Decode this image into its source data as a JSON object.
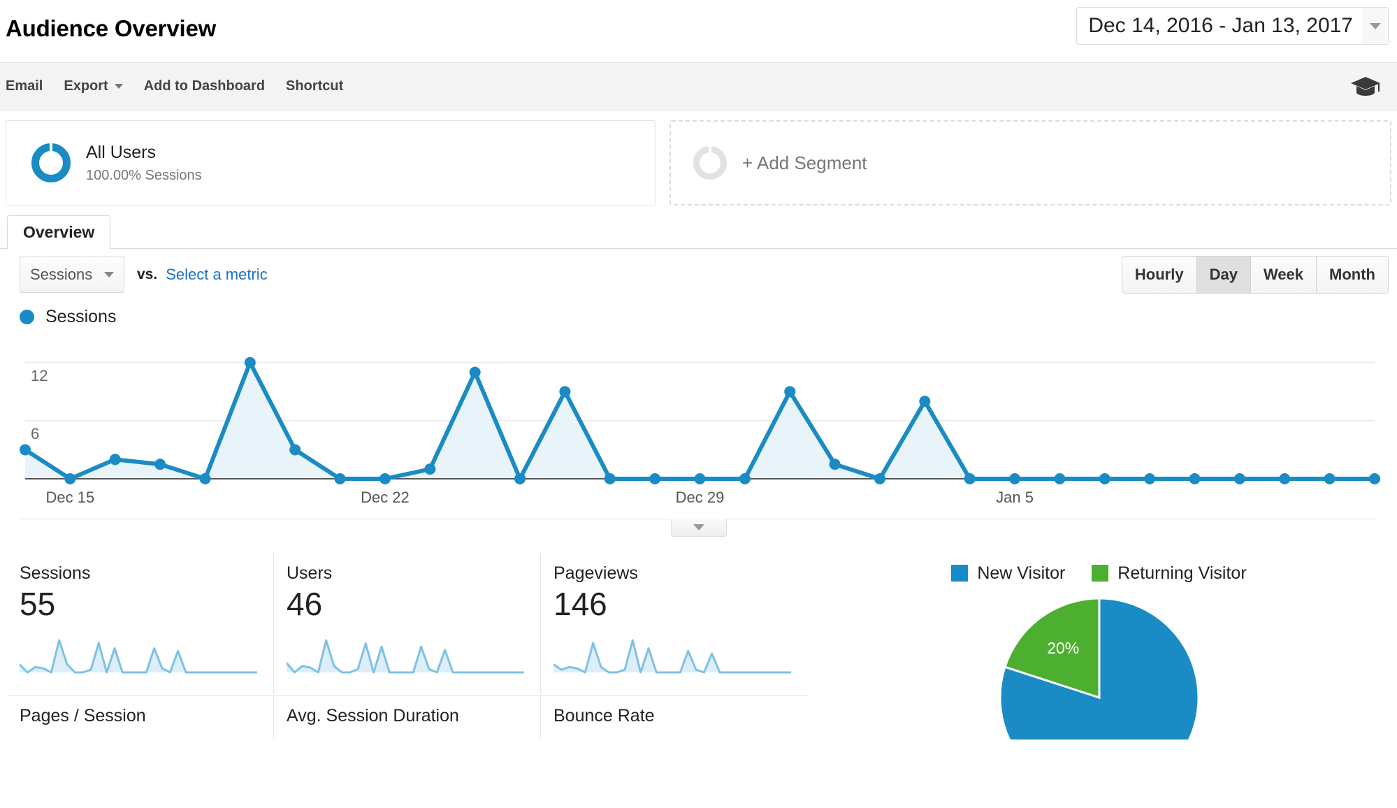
{
  "header": {
    "title": "Audience Overview",
    "date_range": "Dec 14, 2016 - Jan 13, 2017",
    "date_caret_icon": "chevron-down-icon"
  },
  "toolbar": {
    "items": [
      {
        "label": "Email",
        "has_caret": false
      },
      {
        "label": "Export",
        "has_caret": true
      },
      {
        "label": "Add to Dashboard",
        "has_caret": false
      },
      {
        "label": "Shortcut",
        "has_caret": false
      }
    ],
    "help_icon": "graduation-cap-icon"
  },
  "segments": {
    "applied": {
      "name": "All Users",
      "sub": "100.00% Sessions",
      "icon": "segment-ring-icon"
    },
    "add": {
      "label": "+ Add Segment",
      "icon": "segment-ring-icon"
    }
  },
  "tabs": [
    {
      "label": "Overview",
      "active": true
    }
  ],
  "metric_selector": {
    "primary_metric": "Sessions",
    "vs_label": "vs.",
    "secondary_metric_link": "Select a metric",
    "caret_icon": "chevron-down-icon"
  },
  "granularity": {
    "options": [
      "Hourly",
      "Day",
      "Week",
      "Month"
    ],
    "selected": "Day"
  },
  "chart_legend": {
    "label": "Sessions",
    "color": "#1a8bc4"
  },
  "chart_expand": {
    "icon": "chevron-down-icon"
  },
  "metrics": [
    {
      "name": "Sessions",
      "value": "55"
    },
    {
      "name": "Users",
      "value": "46"
    },
    {
      "name": "Pageviews",
      "value": "146"
    },
    {
      "name": "Pages / Session",
      "value": ""
    },
    {
      "name": "Avg. Session Duration",
      "value": ""
    },
    {
      "name": "Bounce Rate",
      "value": ""
    }
  ],
  "visitor_pie": {
    "legend": [
      {
        "label": "New Visitor",
        "color": "#1a8bc4"
      },
      {
        "label": "Returning Visitor",
        "color": "#4caf2f"
      }
    ],
    "slice_label": "20%"
  },
  "colors": {
    "accent_blue": "#1a8bc4",
    "green": "#4caf2f",
    "area_fill": "#e8f3fa",
    "link_blue": "#1a73c8"
  },
  "chart_data": {
    "type": "line",
    "title": "Sessions",
    "xlabel": "",
    "ylabel": "Sessions",
    "ylim": [
      0,
      13.5
    ],
    "yticks": [
      6,
      12
    ],
    "grid": true,
    "legend_position": "top-left",
    "x": [
      "Dec 14",
      "Dec 15",
      "Dec 16",
      "Dec 17",
      "Dec 18",
      "Dec 19",
      "Dec 20",
      "Dec 21",
      "Dec 22",
      "Dec 23",
      "Dec 24",
      "Dec 25",
      "Dec 26",
      "Dec 27",
      "Dec 28",
      "Dec 29",
      "Dec 30",
      "Dec 31",
      "Jan 1",
      "Jan 2",
      "Jan 3",
      "Jan 4",
      "Jan 5",
      "Jan 6",
      "Jan 7",
      "Jan 8",
      "Jan 9",
      "Jan 10",
      "Jan 11",
      "Jan 12",
      "Jan 13"
    ],
    "tick_labels": [
      "Dec 15",
      "Dec 22",
      "Dec 29",
      "Jan 5"
    ],
    "tick_indices": [
      1,
      8,
      15,
      22
    ],
    "series": [
      {
        "name": "Sessions",
        "color": "#1a8bc4",
        "values": [
          3,
          0,
          2,
          1.5,
          0,
          12,
          3,
          0,
          0,
          1,
          11,
          0,
          9,
          0,
          0,
          0,
          0,
          9,
          1.5,
          0,
          8,
          0,
          0,
          0,
          0,
          0,
          0,
          0,
          0,
          0,
          0
        ]
      }
    ]
  },
  "pie_chart_data": {
    "type": "pie",
    "labels": [
      "New Visitor",
      "Returning Visitor"
    ],
    "values": [
      80,
      20
    ],
    "colors": [
      "#1a8bc4",
      "#4caf2f"
    ],
    "shown_labels": [
      "",
      "20%"
    ]
  },
  "sparklines": {
    "sessions": [
      3,
      0,
      2,
      1.5,
      0,
      12,
      3,
      0,
      0,
      1,
      11,
      0,
      9,
      0,
      0,
      0,
      0,
      9,
      1.5,
      0,
      8,
      0,
      0,
      0,
      0,
      0,
      0,
      0,
      0,
      0,
      0
    ],
    "users": [
      3,
      0,
      2,
      1.5,
      0,
      10,
      2,
      0,
      0,
      1,
      9,
      0,
      8,
      0,
      0,
      0,
      0,
      8,
      1,
      0,
      7,
      0,
      0,
      0,
      0,
      0,
      0,
      0,
      0,
      0,
      0
    ],
    "pageviews": [
      3,
      1,
      2,
      1.5,
      0,
      11,
      2,
      0,
      0,
      1,
      12,
      0,
      9,
      0,
      0,
      0,
      0,
      8,
      1,
      0,
      7,
      0,
      0,
      0,
      0,
      0,
      0,
      0,
      0,
      0,
      0
    ]
  }
}
